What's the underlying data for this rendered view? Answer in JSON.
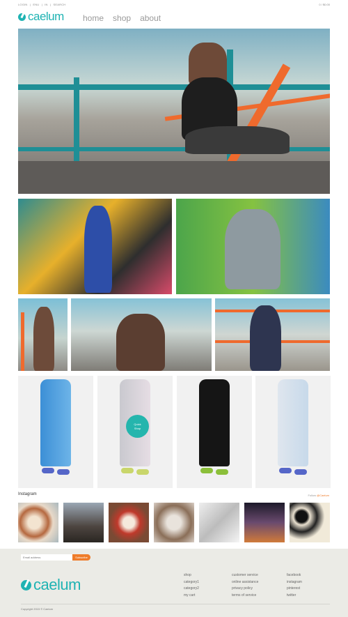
{
  "topbar": {
    "links": [
      "LOGIN",
      "|",
      "ENU",
      "|",
      "IN",
      "|",
      "SEARCH"
    ],
    "cart": "0 / $0.00"
  },
  "header": {
    "logo": "caelum",
    "nav": [
      "home",
      "shop",
      "about"
    ]
  },
  "quickshop": {
    "line1": "Quick",
    "line2": "Shop"
  },
  "instagram": {
    "title": "Instagram",
    "follow_prefix": "Follow",
    "handle": "@Caelum"
  },
  "footer": {
    "email_placeholder": "Email address",
    "subscribe": "Subscribe",
    "logo": "caelum",
    "col1": [
      "shop",
      "category1",
      "category2",
      "my cart"
    ],
    "col2": [
      "customer service",
      "online assistance",
      "privacy policy",
      "terms of service"
    ],
    "col3": [
      "facebook",
      "instagram",
      "pinterest",
      "twitter"
    ],
    "copyright": "Copyright 2015 © Caelum"
  },
  "colors": {
    "accent": "#1fb3b3",
    "orange": "#ef7c2a",
    "footer_bg": "#ebebe6"
  }
}
